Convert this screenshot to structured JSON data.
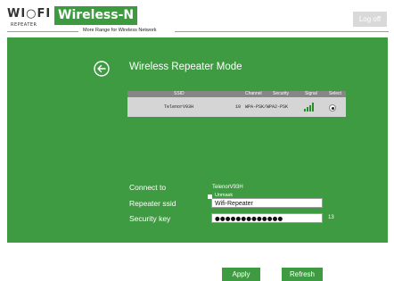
{
  "header": {
    "logo_text": "WI○FI",
    "logo_sub": "REPEATER",
    "brand": "Wireless-N",
    "tagline": "More Range for Wireless Network",
    "logout_label": "Log off"
  },
  "page": {
    "title": "Wireless Repeater Mode"
  },
  "table": {
    "headers": [
      "SSID",
      "Channel",
      "Security",
      "Signal",
      "Select"
    ],
    "rows": [
      {
        "ssid": "TelenorV93H",
        "channel": "10",
        "security": "WPA-PSK/WPA2-PSK",
        "signal_bars": 4,
        "selected": true
      }
    ]
  },
  "form": {
    "connect_to_label": "Connect to",
    "connect_to_value": "TelenorV93H",
    "repeater_ssid_label": "Repeater ssid",
    "repeater_ssid_value": "Wifi-Repeater",
    "security_key_label": "Security key",
    "security_key_value": "●●●●●●●●●●●●●",
    "security_key_length": "13",
    "unmask_label": "Unmask"
  },
  "buttons": {
    "apply": "Apply",
    "refresh": "Refresh"
  },
  "colors": {
    "accent": "#3e9b41",
    "panel_bg": "#3e9b41",
    "table_header": "#868686",
    "table_row": "#d5d5d5"
  }
}
